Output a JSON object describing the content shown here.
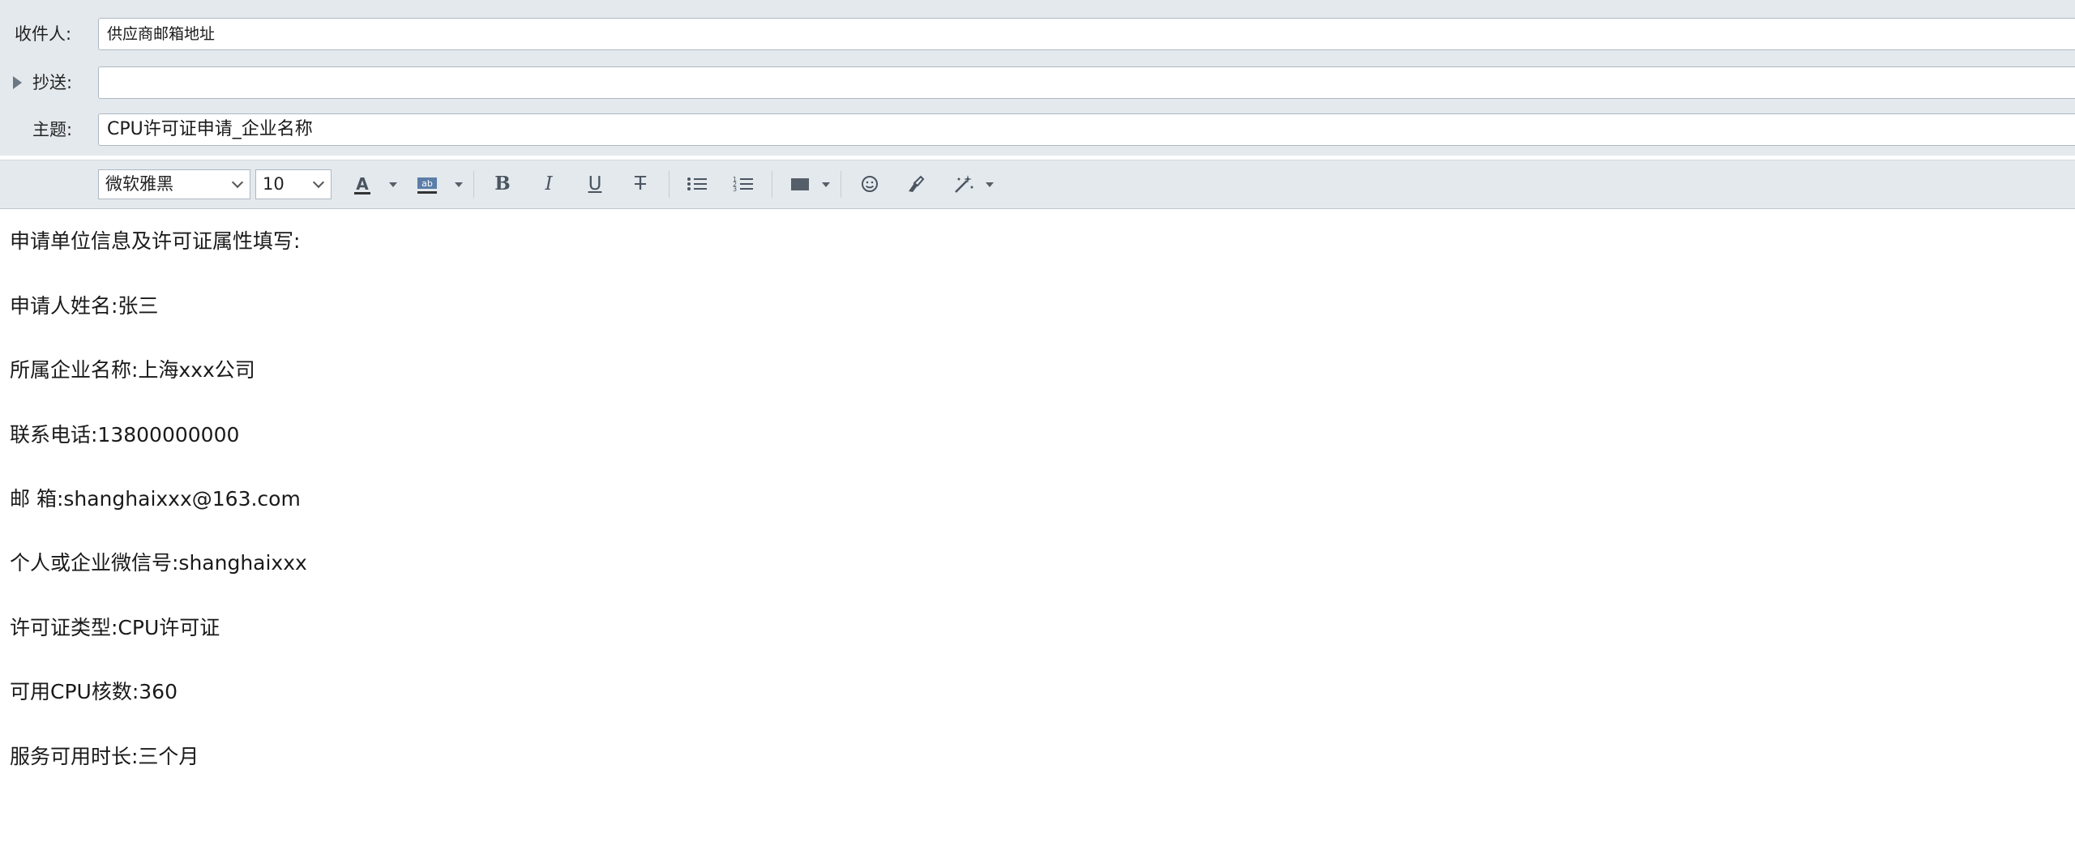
{
  "compose": {
    "to_label": "收件人:",
    "to_value": "供应商邮箱地址",
    "cc_label": "抄送:",
    "cc_value": "",
    "subject_label": "主题:",
    "subject_value": "CPU许可证申请_企业名称"
  },
  "toolbar": {
    "font_family": "微软雅黑",
    "font_size": "10",
    "bold": "B",
    "italic": "I",
    "underline": "U",
    "strikethrough": "T",
    "font_color_icon": "font-color-icon",
    "highlight_icon": "highlight-icon",
    "bullet_list_icon": "bullet-list-icon",
    "numbered_list_icon": "numbered-list-icon",
    "table_icon": "table-icon",
    "emoji_icon": "emoji-icon",
    "format_painter_icon": "format-painter-icon",
    "magic_icon": "magic-wand-icon"
  },
  "body": {
    "lines": [
      "申请单位信息及许可证属性填写:",
      "申请人姓名:张三",
      "所属企业名称:上海xxx公司",
      "联系电话:13800000000",
      "邮 箱:shanghaixxx@163.com",
      "个人或企业微信号:shanghaixxx",
      "许可证类型:CPU许可证",
      "可用CPU核数:360",
      "服务可用时长:三个月"
    ]
  },
  "colors": {
    "header_bg": "#e4e9ee",
    "border": "#aeb8c2",
    "text": "#1a1a1a",
    "icon": "#4a5560"
  }
}
